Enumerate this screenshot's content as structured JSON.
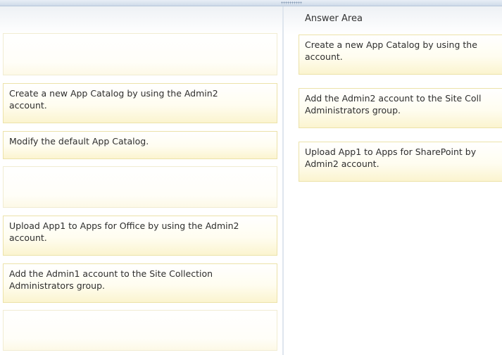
{
  "answer_area": {
    "title": "Answer Area",
    "items": [
      {
        "label": "Create a new App Catalog by using the\naccount."
      },
      {
        "label": "Add the Admin2 account to the Site Coll\nAdministrators group."
      },
      {
        "label": "Upload App1 to Apps for SharePoint by\nAdmin2 account."
      }
    ]
  },
  "source_area": {
    "items": [
      {
        "label": ""
      },
      {
        "label": "Create a new App Catalog by using the Admin2\naccount."
      },
      {
        "label": "Modify the default App Catalog."
      },
      {
        "label": ""
      },
      {
        "label": "Upload App1 to Apps for Office by using the Admin2\naccount."
      },
      {
        "label": "Add the Admin1 account to the Site Collection\nAdministrators group."
      },
      {
        "label": ""
      }
    ]
  }
}
